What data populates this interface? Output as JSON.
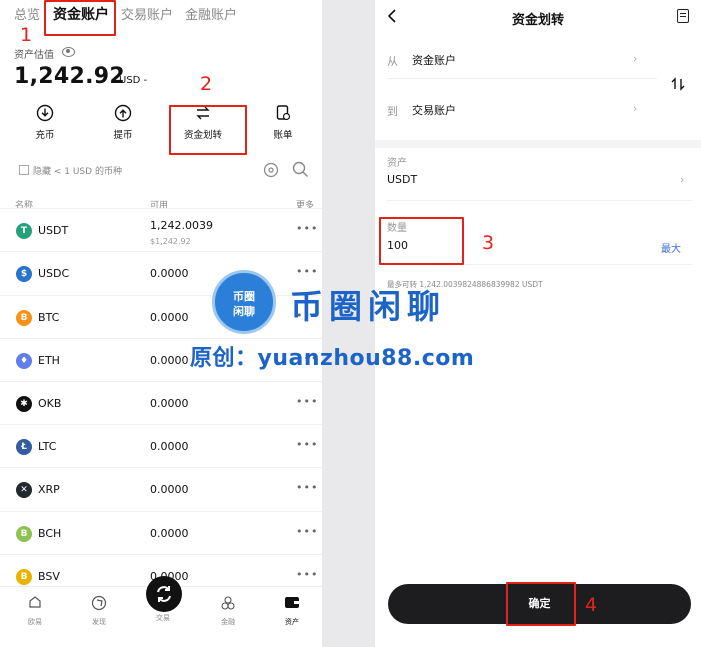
{
  "left": {
    "tabs": [
      "总览",
      "资金账户",
      "交易账户",
      "金融账户"
    ],
    "asset_label": "资产估值",
    "total_value": "1,242.92",
    "total_unit": "USD -",
    "actions": [
      {
        "label": "充币",
        "icon": "download-icon"
      },
      {
        "label": "提币",
        "icon": "upload-icon"
      },
      {
        "label": "资金划转",
        "icon": "transfer-icon"
      },
      {
        "label": "账单",
        "icon": "bill-icon"
      }
    ],
    "hide_small": "隐藏 < 1 USD 的币种",
    "columns": {
      "name": "名称",
      "available": "可用",
      "more": "更多"
    },
    "coins": [
      {
        "name": "USDT",
        "available": "1,242.0039",
        "sub": "$1,242.92",
        "color": "#26a17b",
        "glyph": "T"
      },
      {
        "name": "USDC",
        "available": "0.0000",
        "sub": "",
        "color": "#2775ca",
        "glyph": "$"
      },
      {
        "name": "BTC",
        "available": "0.0000",
        "sub": "",
        "color": "#f7931a",
        "glyph": "B"
      },
      {
        "name": "ETH",
        "available": "0.0000",
        "sub": "",
        "color": "#627eea",
        "glyph": "♦"
      },
      {
        "name": "OKB",
        "available": "0.0000",
        "sub": "",
        "color": "#111111",
        "glyph": "✱"
      },
      {
        "name": "LTC",
        "available": "0.0000",
        "sub": "",
        "color": "#345d9d",
        "glyph": "Ł"
      },
      {
        "name": "XRP",
        "available": "0.0000",
        "sub": "",
        "color": "#23292f",
        "glyph": "✕"
      },
      {
        "name": "BCH",
        "available": "0.0000",
        "sub": "",
        "color": "#8dc351",
        "glyph": "B"
      },
      {
        "name": "BSV",
        "available": "0.0000",
        "sub": "",
        "color": "#eab300",
        "glyph": "B"
      }
    ],
    "more_glyph": "•••",
    "nav": [
      {
        "label": "欧易",
        "icon": "home-icon"
      },
      {
        "label": "发现",
        "icon": "discover-icon"
      },
      {
        "label": "交易",
        "icon": "trade-icon"
      },
      {
        "label": "金融",
        "icon": "finance-icon"
      },
      {
        "label": "资产",
        "icon": "wallet-icon"
      }
    ]
  },
  "right": {
    "title": "资金划转",
    "from_label": "从",
    "from_value": "资金账户",
    "to_label": "到",
    "to_value": "交易账户",
    "asset_label": "资产",
    "asset_value": "USDT",
    "amount_label": "数量",
    "amount_value": "100",
    "max_label": "最大",
    "max_hint": "最多可转 1,242.0039824886839982 USDT",
    "confirm_label": "确定"
  },
  "annotations": [
    "1",
    "2",
    "3",
    "4"
  ],
  "watermark": {
    "badge_line1": "币圈",
    "badge_line2": "闲聊",
    "title": "币圈闲聊",
    "subtitle": "原创：yuanzhou88.com"
  },
  "colors": {
    "annotation_red": "#e2231a",
    "watermark_blue": "#1d64c8",
    "link_blue": "#3b6fd6"
  }
}
